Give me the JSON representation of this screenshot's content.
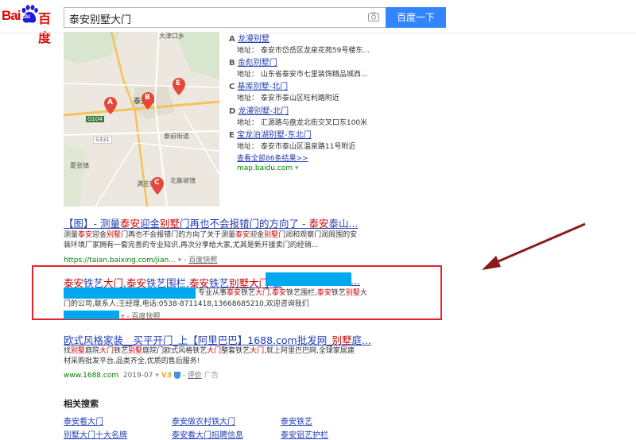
{
  "header": {
    "logo_bai": "Bai",
    "logo_du": "du",
    "logo_cn": "百度",
    "query": "泰安别墅大门",
    "search_button": "百度一下"
  },
  "map": {
    "labels": [
      "大津口乡",
      "泰安市",
      "G104",
      "S331",
      "泰前街道",
      "夏张镇",
      "满庄镇",
      "北集坡镇"
    ],
    "markers": [
      "A",
      "B",
      "C",
      "E"
    ],
    "pois": [
      {
        "letter": "A",
        "name": "龙漫别墅",
        "address": "地址： 泰安市岱岳区龙泉花苑59号楼东..."
      },
      {
        "letter": "B",
        "name": "金彪别墅门",
        "address": "地址： 山东省泰安市七里装饰精品城西..."
      },
      {
        "letter": "C",
        "name": "基库别墅-北门",
        "address": "地址： 泰安市泰山区旺利路附近"
      },
      {
        "letter": "D",
        "name": "龙漫别墅-北门",
        "address": "地址： 汇源路与盘龙北街交叉口东100米"
      },
      {
        "letter": "E",
        "name": "宝龙泊湖别墅-东北门",
        "address": "地址： 泰安市泰山区温泉路11号附近"
      }
    ],
    "more": "查看全部86条结果>>",
    "domain": "map.baidu.com"
  },
  "results": [
    {
      "title": "【图】- 测量泰安迎金别墅门再也不会报错门的方向了 - 泰安泰山...",
      "abstract_1": "测量泰安迎金别墅门再也不会报错门的方向了关于测量泰安迎金别墅门润和观察门润周围的安",
      "abstract_2": "装环境厂家拥有一套完善的专业知识,再次分享给大家,尤其是新开接卖门的经销...",
      "url": "https://taian.baixing.com/jian...",
      "snapshot": "百度快照"
    },
    {
      "title": "泰安铁艺大门,泰安铁艺围栏,泰安铁艺别墅大门-泰",
      "title_tail": "...",
      "abstract_1": "专业从事泰安铁艺大门,泰安铁艺围栏,泰安铁艺别墅大",
      "abstract_2": "门的公司,联系人:王经理,电话:0538-8711418,13668685210,欢迎咨询我们",
      "snapshot": "百度快照"
    },
    {
      "title": "欧式风格家装__买平开门_上【阿里巴巴】1688.com批发网_别墅庭...",
      "abstract_1": "找别墅庭院大门铁艺别墅庭院门欧式风格铁艺大门整套铁艺大门,就上阿里巴巴网,全球家居建",
      "abstract_2": "材采购批发平台,品类齐全,优质的售后服务!",
      "url": "www.1688.com",
      "date": "2019-07",
      "v3": "V3",
      "review": "评价",
      "ad": "广告"
    }
  ],
  "related": {
    "title": "相关搜索",
    "items": [
      "泰安看大门",
      "泰安做农村铁大门",
      "泰安铁艺",
      "别墅大门十大名牌",
      "泰安看大门招聘信息",
      "泰安铝艺护栏"
    ]
  },
  "colors": {
    "link": "#2440b3",
    "highlight": "#c00",
    "accent": "#3385ff",
    "annotation": "#e0262d",
    "arrow": "#8b1a1a"
  }
}
